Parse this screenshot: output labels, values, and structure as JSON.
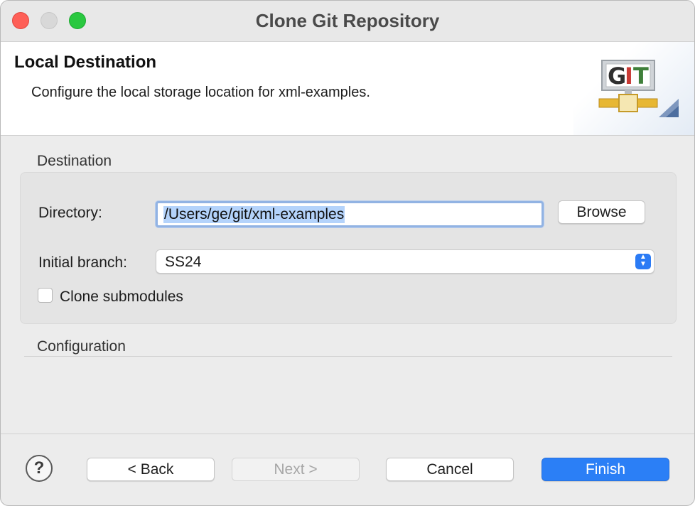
{
  "window": {
    "title": "Clone Git Repository"
  },
  "banner": {
    "title": "Local Destination",
    "description": "Configure the local storage location for xml-examples.",
    "logo_text": "GIT",
    "logo_icon": "git-logo-icon"
  },
  "destination": {
    "section_label": "Destination",
    "directory_label": "Directory:",
    "directory_value": "/Users/ge/git/xml-examples",
    "browse_label": "Browse",
    "branch_label": "Initial branch:",
    "branch_value": "SS24",
    "clone_submodules_label": "Clone submodules",
    "clone_submodules_checked": false
  },
  "configuration": {
    "section_label": "Configuration"
  },
  "footer": {
    "help_icon": "?",
    "back_label": "< Back",
    "next_label": "Next >",
    "cancel_label": "Cancel",
    "finish_label": "Finish"
  },
  "colors": {
    "accent": "#2b7ff6",
    "close": "#fe5f57",
    "maximize": "#2ac840"
  }
}
